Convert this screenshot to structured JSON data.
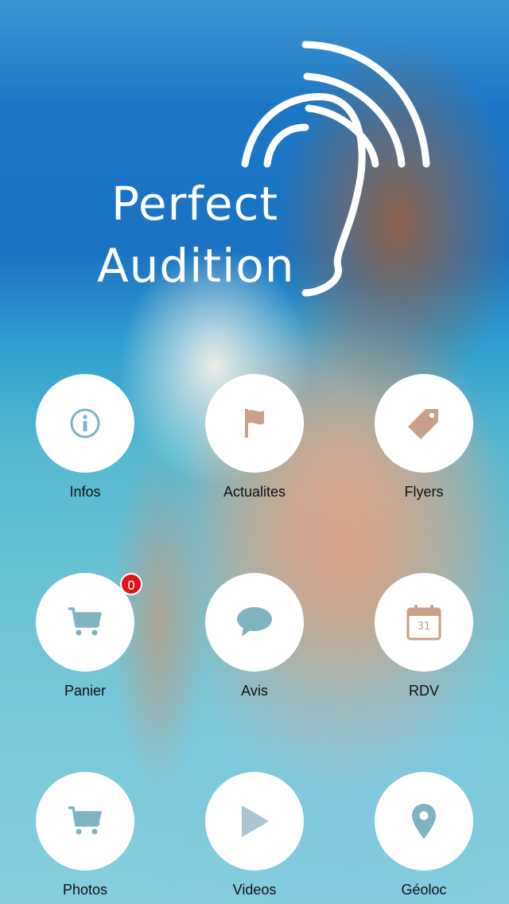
{
  "brand": {
    "line1": "Perfect",
    "line2": "Audition"
  },
  "tiles": [
    {
      "label": "Infos",
      "icon": "info-icon",
      "color": "#7fb3c0"
    },
    {
      "label": "Actualites",
      "icon": "flag-icon",
      "color": "#c9a189"
    },
    {
      "label": "Flyers",
      "icon": "tag-icon",
      "color": "#c9a189"
    },
    {
      "label": "Panier",
      "icon": "cart-icon",
      "color": "#7fb3c0",
      "badge": "0"
    },
    {
      "label": "Avis",
      "icon": "speech-bubble-icon",
      "color": "#7fb3c0"
    },
    {
      "label": "RDV",
      "icon": "calendar-icon",
      "color": "#c9a189",
      "calendar_day": "31"
    },
    {
      "label": "Photos",
      "icon": "cart-icon",
      "color": "#7fb3c0"
    },
    {
      "label": "Videos",
      "icon": "play-icon",
      "color": "#a9c5d0"
    },
    {
      "label": "Géoloc",
      "icon": "map-pin-icon",
      "color": "#7fb3c0"
    }
  ],
  "colors": {
    "icon_teal": "#7fb3c0",
    "icon_tan": "#c9a189",
    "badge_red": "#e0141b"
  }
}
